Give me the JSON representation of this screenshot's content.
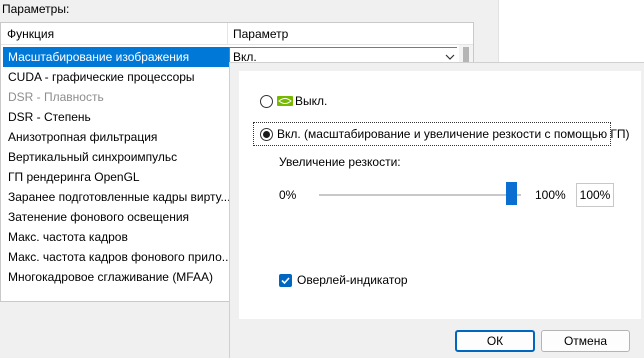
{
  "params_label": "Параметры:",
  "table": {
    "header_function": "Функция",
    "header_param": "Параметр",
    "rows": [
      {
        "label": "Масштабирование изображения",
        "value": "Вкл."
      },
      {
        "label": "CUDA - графические процессоры"
      },
      {
        "label": "DSR - Плавность"
      },
      {
        "label": "DSR - Степень"
      },
      {
        "label": "Анизотропная фильтрация"
      },
      {
        "label": "Вертикальный синхроимпульс"
      },
      {
        "label": "ГП рендеринга OpenGL"
      },
      {
        "label": "Заранее подготовленные кадры вирту..."
      },
      {
        "label": "Затенение фонового освещения"
      },
      {
        "label": "Макс. частота кадров"
      },
      {
        "label": "Макс. частота кадров фонового прило..."
      },
      {
        "label": "Многокадровое сглаживание (MFAA)"
      }
    ]
  },
  "dialog": {
    "option_off": "Выкл.",
    "option_on": "Вкл. (масштабирование и увеличение резкости с помощью ГП)",
    "sharpness_label": "Увеличение резкости:",
    "slider_min": "0%",
    "slider_max": "100%",
    "slider_value": "100%",
    "slider_level": 1.0,
    "overlay_label": "Оверлей-индикатор",
    "ok": "ОК",
    "cancel": "Отмена"
  }
}
